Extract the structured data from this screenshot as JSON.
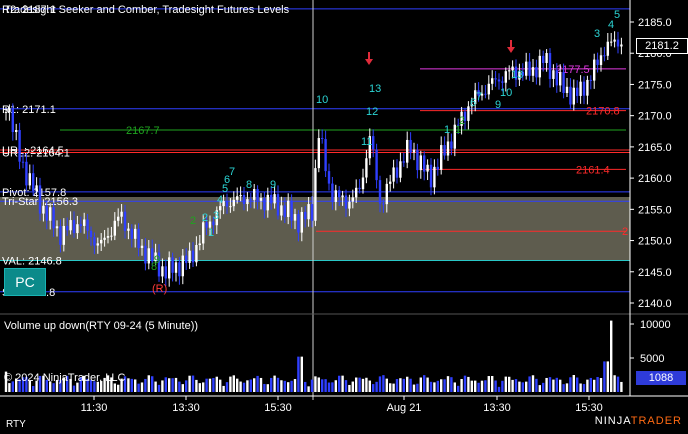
{
  "chart_title": "Tradesight Seeker and Comber, Tradesight Futures Levels",
  "volume_title": "Volume up down(RTY 09-24 (5 Minute))",
  "copyright": "© 2024 NinjaTrader, LLC",
  "instrument_tab": "RTY",
  "logo": {
    "part1": "NINJA",
    "part2": "TRADER"
  },
  "pc_button": "PC",
  "current_price": "2181.2",
  "current_volume": "1088",
  "levels": [
    {
      "label": "R2: 2187.1",
      "price": 2187.1,
      "color": "#2f3fff"
    },
    {
      "label": "R1: 2171.1",
      "price": 2171.1,
      "color": "#2f3fff"
    },
    {
      "label": "URL: 2164.5",
      "price": 2164.5,
      "color": "#ff2a2a"
    },
    {
      "label": "URL2: 2164.1",
      "price": 2164.1,
      "color": "#ff2a2a"
    },
    {
      "label": "Pivot: 2157.8",
      "price": 2157.8,
      "color": "#2f3fff"
    },
    {
      "label": "Tri-Star: 2156.3",
      "price": 2156.3,
      "color": "#2f3fff"
    },
    {
      "label": "VAL: 2146.8",
      "price": 2146.8,
      "color": "#29c7c7"
    },
    {
      "label": "S1: 2141.8",
      "price": 2141.8,
      "color": "#2f3fff"
    }
  ],
  "signal_levels": [
    {
      "label": "2177.5",
      "price": 2177.5,
      "color": "#e23be2"
    },
    {
      "label": "2170.8",
      "price": 2170.8,
      "color": "#ff2a2a"
    },
    {
      "label": "2167.7",
      "price": 2167.7,
      "color": "#1fa31f"
    },
    {
      "label": "2161.4",
      "price": 2161.4,
      "color": "#ff2a2a"
    },
    {
      "label": "2",
      "price": 2151.5,
      "color": "#ff2a2a"
    }
  ],
  "r_marker": "(R)",
  "chart_data": {
    "type": "candlestick",
    "title": "Tradesight Seeker and Comber, Tradesight Futures Levels",
    "price_axis": {
      "min": 2138,
      "max": 2188,
      "ticks": [
        2140,
        2145,
        2150,
        2155,
        2160,
        2165,
        2170,
        2175,
        2180,
        2185
      ]
    },
    "time_axis": {
      "ticks": [
        "11:30",
        "13:30",
        "15:30",
        "Aug 21",
        "13:30",
        "15:30"
      ]
    },
    "volume_axis": {
      "ticks": [
        5000,
        10000
      ]
    },
    "value_area": {
      "low": 2146.8,
      "high": 2157.2
    }
  }
}
